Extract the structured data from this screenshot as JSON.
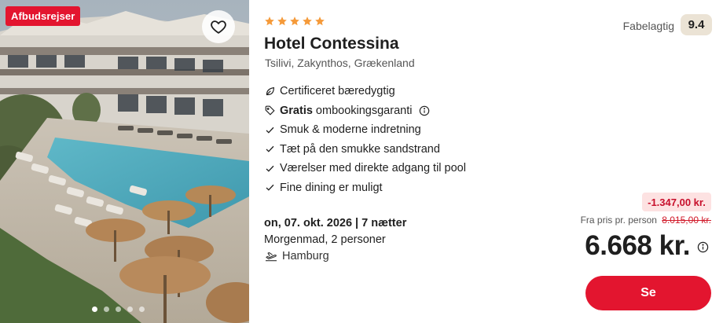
{
  "image": {
    "badge": "Afbudsrejser",
    "favorite_icon": "heart-outline-icon",
    "carousel": {
      "dots": 5,
      "active_index": 0
    }
  },
  "hotel": {
    "stars": 5,
    "star_color": "#f59a3a",
    "name": "Hotel Contessina",
    "location": "Tsilivi, Zakynthos, Grækenland"
  },
  "features": [
    {
      "icon": "leaf-icon",
      "bold": "",
      "text": "Certificeret bæredygtig",
      "info": false
    },
    {
      "icon": "tag-icon",
      "bold": "Gratis",
      "text": "ombookingsgaranti",
      "info": true
    },
    {
      "icon": "check-icon",
      "bold": "",
      "text": "Smuk & moderne indretning",
      "info": false
    },
    {
      "icon": "check-icon",
      "bold": "",
      "text": "Tæt på den smukke sandstrand",
      "info": false
    },
    {
      "icon": "check-icon",
      "bold": "",
      "text": "Værelser med direkte adgang til pool",
      "info": false
    },
    {
      "icon": "check-icon",
      "bold": "",
      "text": "Fine dining er muligt",
      "info": false
    }
  ],
  "trip": {
    "date": "on, 07. okt. 2026 | 7 nætter",
    "board": "Morgenmad, 2 personer",
    "departure": "Hamburg",
    "departure_icon": "plane-takeoff-icon"
  },
  "rating": {
    "label": "Fabelagtig",
    "score": "9.4"
  },
  "pricing": {
    "discount": "-1.347,00 kr.",
    "from_label": "Fra pris pr. person",
    "old_price": "8.015,00 kr.",
    "price": "6.668 kr.",
    "cta_label": "Se"
  },
  "colors": {
    "brand_red": "#e3152f",
    "discount_bg": "#fde2e2",
    "discount_text": "#c70f2b",
    "rating_bg": "#ebe3d5"
  }
}
